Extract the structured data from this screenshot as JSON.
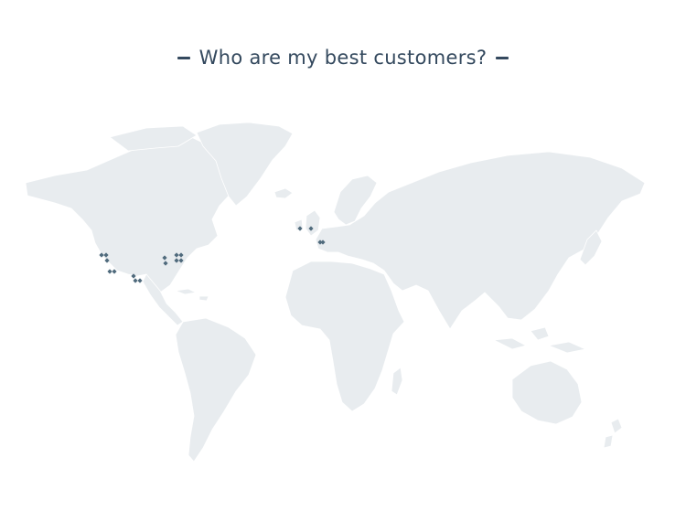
{
  "title": {
    "text": "Who are my best customers?"
  },
  "map": {
    "land_color": "#e8ecef",
    "marker_color": "#4f6a7c",
    "markers": [
      {
        "region": "US West"
      },
      {
        "region": "US West"
      },
      {
        "region": "US West"
      },
      {
        "region": "US Southwest"
      },
      {
        "region": "US Southwest"
      },
      {
        "region": "Texas"
      },
      {
        "region": "Texas"
      },
      {
        "region": "Texas"
      },
      {
        "region": "US Midwest"
      },
      {
        "region": "US Midwest"
      },
      {
        "region": "US East"
      },
      {
        "region": "US East"
      },
      {
        "region": "US East"
      },
      {
        "region": "US East"
      },
      {
        "region": "Ireland"
      },
      {
        "region": "United Kingdom"
      },
      {
        "region": "France"
      },
      {
        "region": "Italy"
      }
    ]
  }
}
